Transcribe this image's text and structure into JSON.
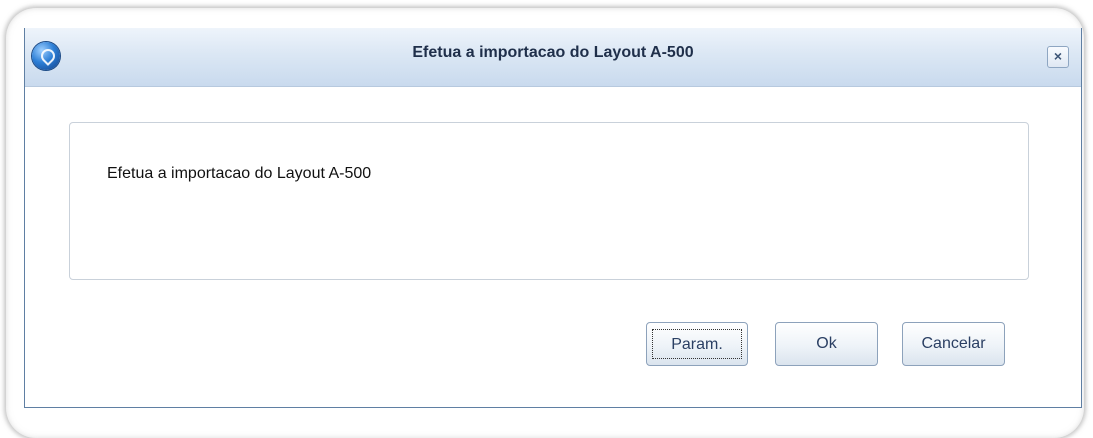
{
  "window": {
    "title": "Efetua a importacao do Layout A-500",
    "close_glyph": "×"
  },
  "message": {
    "text": "Efetua a importacao do Layout A-500"
  },
  "buttons": {
    "param_label": "Param.",
    "ok_label": "Ok",
    "cancel_label": "Cancelar"
  },
  "colors": {
    "title_text": "#1f2f4a",
    "border": "#5f7fa3"
  },
  "icons": {
    "title": "app-logo-icon",
    "close": "close-icon"
  }
}
